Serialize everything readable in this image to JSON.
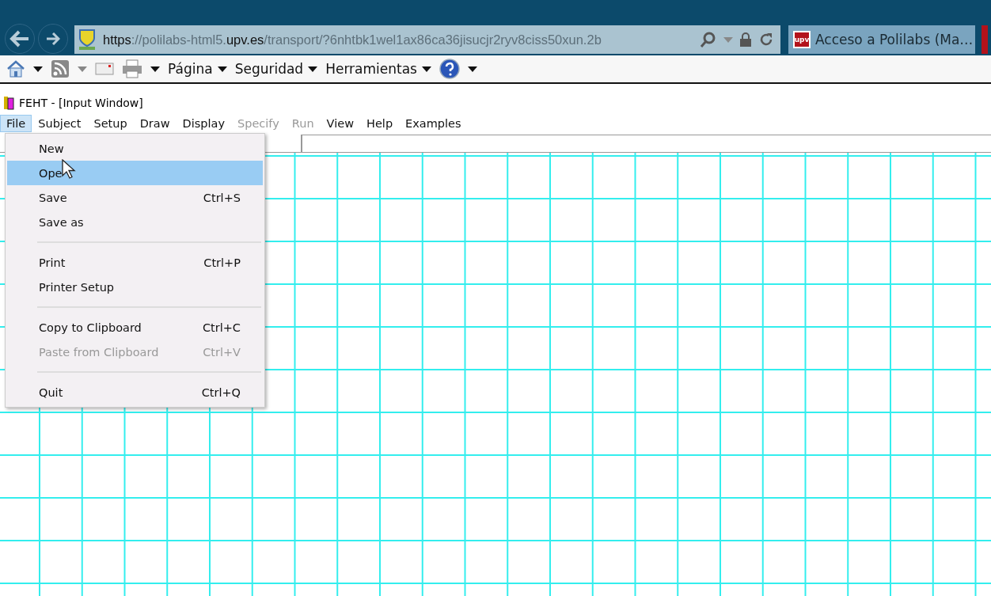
{
  "browser": {
    "url_parts": [
      {
        "text": "https",
        "strong": true
      },
      {
        "text": "://polilabs-html5.",
        "strong": false
      },
      {
        "text": "upv.es",
        "strong": true
      },
      {
        "text": "/transport/?6nhtbk1wel1ax86ca36jisucjr2ryv8ciss50xun.2b",
        "strong": false
      }
    ],
    "tab": {
      "icon_text": "upv",
      "title": "Acceso a Polilabs (Ma…",
      "selected": true
    },
    "command_menus": [
      "Página",
      "Seguridad",
      "Herramientas"
    ]
  },
  "app": {
    "title": "FEHT - [Input Window]",
    "menu": [
      {
        "label": "File",
        "selected": true,
        "disabled": false
      },
      {
        "label": "Subject",
        "selected": false,
        "disabled": false
      },
      {
        "label": "Setup",
        "selected": false,
        "disabled": false
      },
      {
        "label": "Draw",
        "selected": false,
        "disabled": false
      },
      {
        "label": "Display",
        "selected": false,
        "disabled": false
      },
      {
        "label": "Specify",
        "selected": false,
        "disabled": true
      },
      {
        "label": "Run",
        "selected": false,
        "disabled": true
      },
      {
        "label": "View",
        "selected": false,
        "disabled": false
      },
      {
        "label": "Help",
        "selected": false,
        "disabled": false
      },
      {
        "label": "Examples",
        "selected": false,
        "disabled": false
      }
    ],
    "file_menu": [
      {
        "kind": "item",
        "label": "New",
        "selected": false,
        "disabled": false
      },
      {
        "kind": "item",
        "label": "Ope",
        "selected": true,
        "disabled": false
      },
      {
        "kind": "item",
        "label": "Save",
        "shortcut": "Ctrl+S",
        "selected": false,
        "disabled": false
      },
      {
        "kind": "item",
        "label": "Save as",
        "selected": false,
        "disabled": false
      },
      {
        "kind": "separator"
      },
      {
        "kind": "item",
        "label": "Print",
        "shortcut": "Ctrl+P",
        "selected": false,
        "disabled": false
      },
      {
        "kind": "item",
        "label": "Printer Setup",
        "selected": false,
        "disabled": false
      },
      {
        "kind": "separator"
      },
      {
        "kind": "item",
        "label": "Copy to Clipboard",
        "shortcut": "Ctrl+C",
        "selected": false,
        "disabled": false
      },
      {
        "kind": "item",
        "label": "Paste from Clipboard",
        "shortcut": "Ctrl+V",
        "selected": false,
        "disabled": true
      },
      {
        "kind": "separator"
      },
      {
        "kind": "item",
        "label": "Quit",
        "shortcut": "Ctrl+Q",
        "selected": false,
        "disabled": false
      }
    ]
  }
}
